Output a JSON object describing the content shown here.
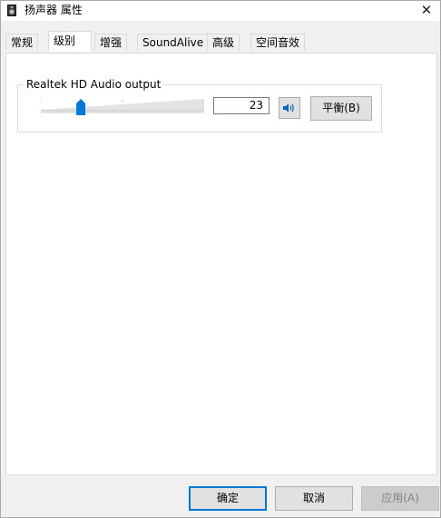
{
  "window": {
    "title": "扬声器 属性",
    "close_glyph": "✕"
  },
  "tabs": [
    {
      "label": "常规",
      "active": false
    },
    {
      "label": "级别",
      "active": true
    },
    {
      "label": "增强",
      "active": false
    },
    {
      "label": "SoundAlive",
      "active": false
    },
    {
      "label": "高级",
      "active": false
    },
    {
      "label": "空间音效",
      "active": false
    }
  ],
  "levels": {
    "device_name": "Realtek HD Audio output",
    "volume": "23",
    "volume_fraction": 0.23,
    "mute_icon": "speaker-icon",
    "balance_label": "平衡(B)"
  },
  "footer": {
    "ok_label": "确定",
    "cancel_label": "取消",
    "apply_label": "应用(A)"
  },
  "colors": {
    "accent": "#0078d7",
    "slider_thumb": "#0078d7",
    "speaker_icon": "#0a64b4"
  }
}
